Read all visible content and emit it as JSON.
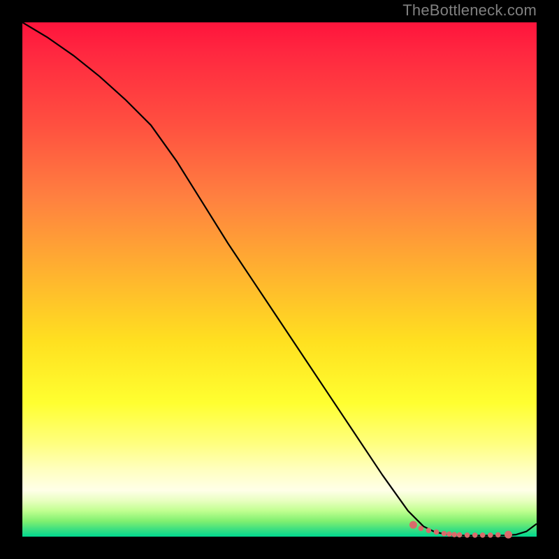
{
  "watermark": "TheBottleneck.com",
  "chart_data": {
    "type": "line",
    "title": "",
    "xlabel": "",
    "ylabel": "",
    "xlim": [
      0,
      100
    ],
    "ylim": [
      0,
      100
    ],
    "grid": false,
    "series": [
      {
        "name": "curve",
        "x": [
          0,
          5,
          10,
          15,
          20,
          25,
          30,
          35,
          40,
          45,
          50,
          55,
          60,
          65,
          70,
          75,
          78,
          80,
          82,
          84,
          86,
          88,
          90,
          92,
          94,
          96,
          98,
          100
        ],
        "y": [
          100,
          97,
          93.5,
          89.5,
          85,
          80,
          73,
          65,
          57,
          49.5,
          42,
          34.5,
          27,
          19.5,
          12,
          5,
          2,
          1,
          0.5,
          0.3,
          0.2,
          0.2,
          0.2,
          0.2,
          0.25,
          0.4,
          1,
          2.5
        ]
      }
    ],
    "annotations": {
      "flat_zone_dots_x": [
        76,
        77.5,
        79,
        80.5,
        82,
        83,
        84,
        85,
        86.5,
        88,
        89.5,
        91,
        92.5,
        94.5
      ],
      "flat_zone_dots_y": [
        2.3,
        1.6,
        1.2,
        0.9,
        0.6,
        0.5,
        0.4,
        0.35,
        0.3,
        0.3,
        0.3,
        0.3,
        0.35,
        0.4
      ]
    }
  },
  "colors": {
    "background": "#000000",
    "watermark": "#808080",
    "curve": "#000000",
    "dots": "#d96b6b",
    "gradient_top": "#ff143c",
    "gradient_bottom": "#00d890"
  }
}
